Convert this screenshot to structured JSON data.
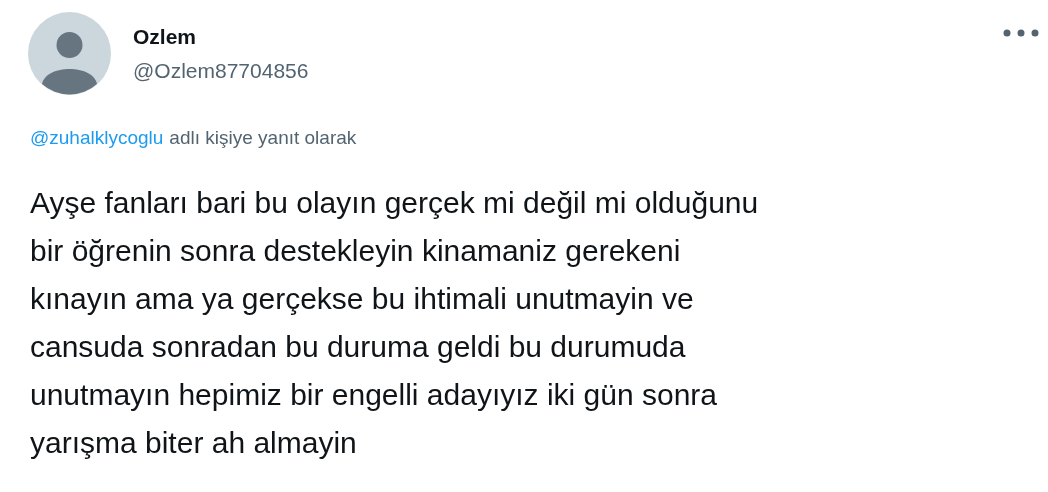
{
  "author": {
    "name": "Ozlem",
    "handle": "@Ozlem87704856"
  },
  "reply": {
    "mention": "@zuhalklycoglu",
    "suffix": "adlı kişiye yanıt olarak"
  },
  "body_lines": [
    "Ayşe fanları bari bu olayın gerçek mi değil mi olduğunu",
    "bir öğrenin sonra destekleyin kinamaniz gerekeni",
    "kınayın ama ya gerçekse bu ihtimali unutmayin ve",
    "cansuda sonradan bu duruma geldi bu durumuda",
    "unutmayın hepimiz bir engelli adayıyız iki gün sonra",
    "yarışma biter ah almayin"
  ]
}
